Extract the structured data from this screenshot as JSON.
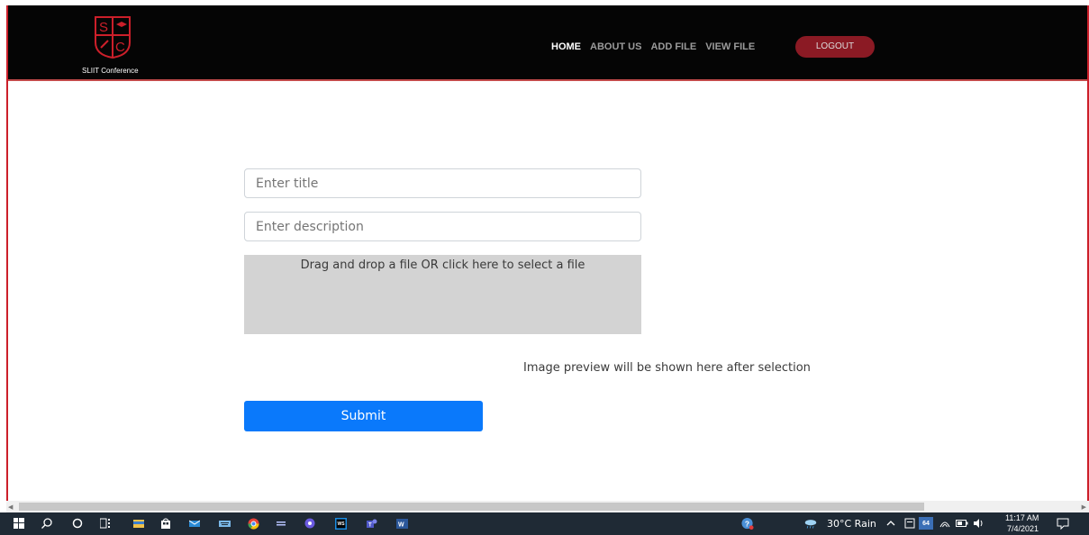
{
  "app": {
    "logo_caption": "SLIIT Conference"
  },
  "nav": {
    "items": [
      {
        "label": "HOME",
        "active": true
      },
      {
        "label": "ABOUT US",
        "active": false
      },
      {
        "label": "ADD FILE",
        "active": false
      },
      {
        "label": "VIEW FILE",
        "active": false
      }
    ],
    "logout_label": "LOGOUT"
  },
  "form": {
    "title_placeholder": "Enter title",
    "title_value": "",
    "description_placeholder": "Enter description",
    "description_value": "",
    "dropzone_text": "Drag and drop a file OR click here to select a file",
    "preview_text": "Image preview will be shown here after selection",
    "submit_label": "Submit"
  },
  "taskbar": {
    "weather": "30°C  Rain",
    "clock_time": "11:17 AM",
    "clock_date": "7/4/2021",
    "badge_count": "64",
    "pinned_apps": [
      "windows-start-icon",
      "search-icon",
      "cortana-icon",
      "task-view-icon",
      "file-explorer-icon",
      "store-icon",
      "mail-icon",
      "keyboard-icon",
      "chrome-icon",
      "app-icon",
      "app-icon-2",
      "webstorm-icon",
      "teams-icon",
      "word-icon"
    ]
  },
  "colors": {
    "navbar_bg": "#050505",
    "accent_red": "#cc1f2a",
    "logout_bg": "#8b1a24",
    "submit_bg": "#0a79fb",
    "dropzone_bg": "#d3d3d3"
  }
}
